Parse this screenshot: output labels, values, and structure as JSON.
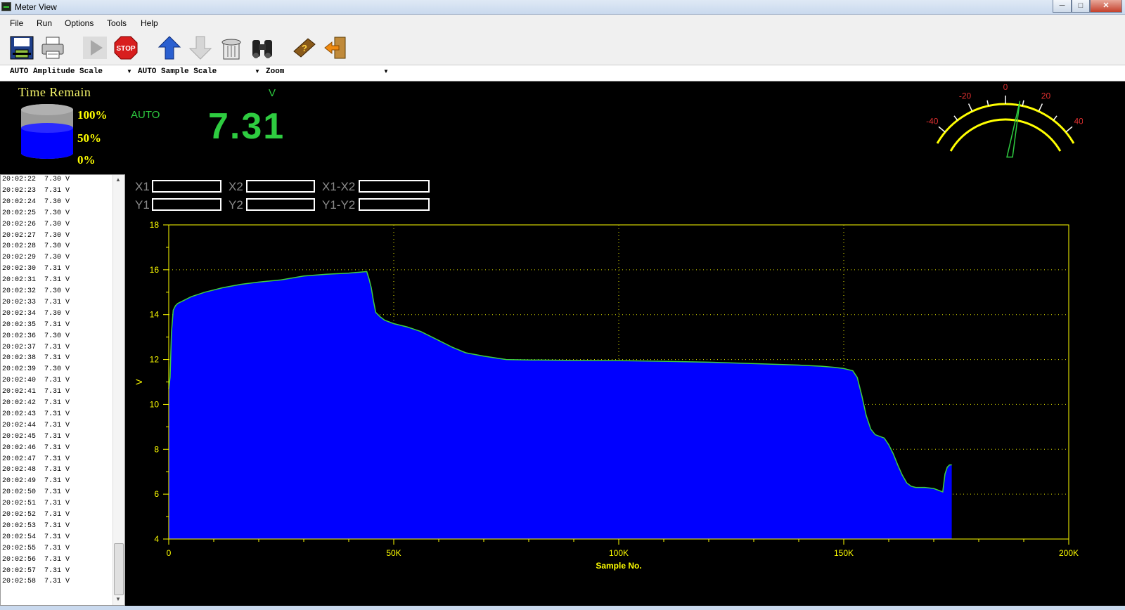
{
  "window": {
    "title": "Meter View",
    "minimize": "─",
    "maximize": "□",
    "close": "✕"
  },
  "menu": [
    "File",
    "Run",
    "Options",
    "Tools",
    "Help"
  ],
  "toolbar": [
    {
      "name": "save-icon"
    },
    {
      "name": "print-icon"
    },
    {
      "name": "play-icon"
    },
    {
      "name": "stop-icon",
      "label": "STOP"
    },
    {
      "name": "upload-icon"
    },
    {
      "name": "download-icon"
    },
    {
      "name": "trash-icon"
    },
    {
      "name": "binoculars-icon"
    },
    {
      "name": "help-book-icon"
    },
    {
      "name": "exit-icon"
    }
  ],
  "combos": {
    "amplitude": "AUTO Amplitude Scale",
    "sample": "AUTO Sample Scale",
    "zoom": "Zoom"
  },
  "battery": {
    "label": "Time Remain",
    "p100": "100%",
    "p50": "50%",
    "p0": "0%",
    "level": 0.58
  },
  "meter": {
    "mode": "AUTO",
    "unit": "V",
    "value": "7.31"
  },
  "gauge": {
    "ticks": [
      "-40",
      "-20",
      "0",
      "20",
      "40"
    ],
    "needle": 8
  },
  "log": [
    "20:02:22  7.30 V",
    "20:02:23  7.31 V",
    "20:02:24  7.30 V",
    "20:02:25  7.30 V",
    "20:02:26  7.30 V",
    "20:02:27  7.30 V",
    "20:02:28  7.30 V",
    "20:02:29  7.30 V",
    "20:02:30  7.31 V",
    "20:02:31  7.31 V",
    "20:02:32  7.30 V",
    "20:02:33  7.31 V",
    "20:02:34  7.30 V",
    "20:02:35  7.31 V",
    "20:02:36  7.30 V",
    "20:02:37  7.31 V",
    "20:02:38  7.31 V",
    "20:02:39  7.30 V",
    "20:02:40  7.31 V",
    "20:02:41  7.31 V",
    "20:02:42  7.31 V",
    "20:02:43  7.31 V",
    "20:02:44  7.31 V",
    "20:02:45  7.31 V",
    "20:02:46  7.31 V",
    "20:02:47  7.31 V",
    "20:02:48  7.31 V",
    "20:02:49  7.31 V",
    "20:02:50  7.31 V",
    "20:02:51  7.31 V",
    "20:02:52  7.31 V",
    "20:02:53  7.31 V",
    "20:02:54  7.31 V",
    "20:02:55  7.31 V",
    "20:02:56  7.31 V",
    "20:02:57  7.31 V",
    "20:02:58  7.31 V"
  ],
  "cursors": {
    "x1": "X1",
    "x2": "X2",
    "x1x2": "X1-X2",
    "y1": "Y1",
    "y2": "Y2",
    "y1y2": "Y1-Y2"
  },
  "chart_data": {
    "type": "area",
    "xlabel": "Sample No.",
    "ylabel": "V",
    "xlim": [
      0,
      200000
    ],
    "ylim": [
      4,
      18
    ],
    "x_ticks": [
      0,
      50000,
      100000,
      150000,
      200000
    ],
    "x_tick_labels": [
      "0",
      "50K",
      "100K",
      "150K",
      "200K"
    ],
    "y_ticks": [
      4,
      6,
      8,
      10,
      12,
      14,
      16,
      18
    ],
    "grid": true,
    "colors": {
      "fill": "#0000ff",
      "line": "#3ecf3e",
      "axis": "#ffff00",
      "text": "#ffff00"
    },
    "series": [
      {
        "x": [
          0,
          300,
          600,
          1000,
          1500,
          2000,
          3000,
          5000,
          8000,
          12000,
          16000,
          20000,
          25000,
          30000,
          35000,
          40000,
          44000,
          44500,
          45000,
          45500,
          46000,
          47000,
          48000,
          50000,
          53000,
          56000,
          58000,
          60000,
          63000,
          66000,
          70000,
          75000,
          80000,
          90000,
          100000,
          110000,
          120000,
          130000,
          140000,
          145000,
          148000,
          150000,
          152000,
          153000,
          154000,
          155000,
          156000,
          157000,
          159000,
          160000,
          161000,
          162000,
          163000,
          164000,
          165000,
          166000,
          168000,
          170000,
          172000,
          172500,
          173000,
          173500,
          174000
        ],
        "y": [
          10.7,
          11.2,
          13.2,
          14.2,
          14.4,
          14.5,
          14.6,
          14.8,
          15.0,
          15.2,
          15.35,
          15.45,
          15.55,
          15.72,
          15.8,
          15.85,
          15.92,
          15.6,
          15.2,
          14.6,
          14.1,
          13.9,
          13.75,
          13.6,
          13.45,
          13.25,
          13.05,
          12.85,
          12.55,
          12.3,
          12.15,
          12.0,
          11.98,
          11.96,
          11.95,
          11.92,
          11.88,
          11.82,
          11.75,
          11.7,
          11.65,
          11.6,
          11.5,
          11.2,
          10.4,
          9.5,
          8.9,
          8.65,
          8.5,
          8.2,
          7.8,
          7.3,
          6.85,
          6.5,
          6.35,
          6.3,
          6.3,
          6.25,
          6.1,
          6.9,
          7.2,
          7.3,
          7.31
        ]
      }
    ]
  }
}
